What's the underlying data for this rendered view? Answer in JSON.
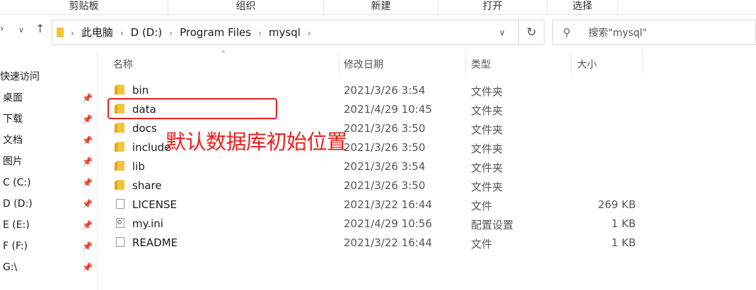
{
  "ribbon": {
    "groups": [
      "剪贴板",
      "组织",
      "新建",
      "打开",
      "选择"
    ]
  },
  "address": {
    "crumbs": [
      "此电脑",
      "D (D:)",
      "Program Files",
      "mysql"
    ]
  },
  "search": {
    "placeholder": "搜索\"mysql\""
  },
  "nav": {
    "quick_access": "快速访问",
    "items": [
      {
        "label": "桌面",
        "pinned": true
      },
      {
        "label": "下载",
        "pinned": true
      },
      {
        "label": "文档",
        "pinned": true
      },
      {
        "label": "图片",
        "pinned": true
      },
      {
        "label": "C (C:)",
        "pinned": true
      },
      {
        "label": "D (D:)",
        "pinned": true
      },
      {
        "label": "E (E:)",
        "pinned": true
      },
      {
        "label": "F (F:)",
        "pinned": true
      },
      {
        "label": "G:\\",
        "pinned": true
      }
    ]
  },
  "columns": {
    "name": "名称",
    "date": "修改日期",
    "type": "类型",
    "size": "大小"
  },
  "files": [
    {
      "name": "bin",
      "date": "2021/3/26 3:54",
      "type": "文件夹",
      "size": "",
      "icon": "folder-icon"
    },
    {
      "name": "data",
      "date": "2021/4/29 10:45",
      "type": "文件夹",
      "size": "",
      "icon": "folder-icon"
    },
    {
      "name": "docs",
      "date": "2021/3/26 3:50",
      "type": "文件夹",
      "size": "",
      "icon": "folder-icon"
    },
    {
      "name": "include",
      "date": "2021/3/26 3:50",
      "type": "文件夹",
      "size": "",
      "icon": "folder-icon"
    },
    {
      "name": "lib",
      "date": "2021/3/26 3:54",
      "type": "文件夹",
      "size": "",
      "icon": "folder-icon"
    },
    {
      "name": "share",
      "date": "2021/3/26 3:50",
      "type": "文件夹",
      "size": "",
      "icon": "folder-icon"
    },
    {
      "name": "LICENSE",
      "date": "2021/3/22 16:44",
      "type": "文件",
      "size": "269 KB",
      "icon": "file-icon"
    },
    {
      "name": "my.ini",
      "date": "2021/4/29 10:56",
      "type": "配置设置",
      "size": "1 KB",
      "icon": "ini-file-icon"
    },
    {
      "name": "README",
      "date": "2021/3/22 16:44",
      "type": "文件",
      "size": "1 KB",
      "icon": "file-icon"
    }
  ],
  "annotation": {
    "text": "默认数据库初始位置",
    "color": "#e8201f"
  }
}
